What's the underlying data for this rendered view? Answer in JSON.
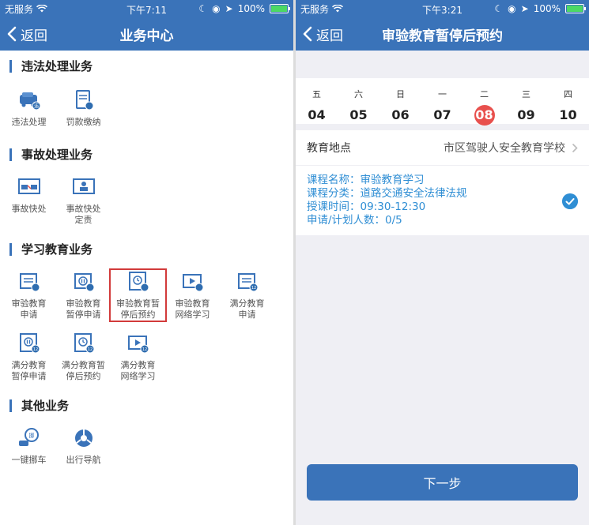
{
  "left": {
    "status": {
      "carrier": "无服务",
      "time": "下午7:11",
      "battery": "100%"
    },
    "nav": {
      "back": "返回",
      "title": "业务中心"
    },
    "sections": [
      {
        "title": "违法处理业务",
        "items": [
          {
            "label": "违法处理",
            "icon": "car-violation-icon"
          },
          {
            "label": "罚款缴纳",
            "icon": "fine-payment-icon"
          }
        ]
      },
      {
        "title": "事故处理业务",
        "items": [
          {
            "label": "事故快处",
            "icon": "accident-quick-icon"
          },
          {
            "label": "事故快处\n定责",
            "icon": "accident-liability-icon"
          }
        ]
      },
      {
        "title": "学习教育业务",
        "items": [
          {
            "label": "审验教育\n申请",
            "icon": "document-icon"
          },
          {
            "label": "审验教育\n暂停申请",
            "icon": "pause-document-icon"
          },
          {
            "label": "审验教育暂\n停后预约",
            "icon": "clock-document-icon",
            "selected": true
          },
          {
            "label": "审验教育\n网络学习",
            "icon": "video-icon"
          },
          {
            "label": "满分教育\n申请",
            "icon": "document-12-icon"
          },
          {
            "label": "满分教育\n暂停申请",
            "icon": "pause-document-12-icon"
          },
          {
            "label": "满分教育暂\n停后预约",
            "icon": "clock-document-12-icon"
          },
          {
            "label": "满分教育\n网络学习",
            "icon": "video-12-icon"
          }
        ]
      },
      {
        "title": "其他业务",
        "items": [
          {
            "label": "一键挪车",
            "icon": "move-car-icon"
          },
          {
            "label": "出行导航",
            "icon": "navigation-icon"
          }
        ]
      }
    ]
  },
  "right": {
    "status": {
      "carrier": "无服务",
      "time": "下午3:21",
      "battery": "100%"
    },
    "nav": {
      "back": "返回",
      "title": "审验教育暂停后预约"
    },
    "days": [
      {
        "weekday": "五",
        "date": "04"
      },
      {
        "weekday": "六",
        "date": "05"
      },
      {
        "weekday": "日",
        "date": "06"
      },
      {
        "weekday": "一",
        "date": "07"
      },
      {
        "weekday": "二",
        "date": "08",
        "active": true
      },
      {
        "weekday": "三",
        "date": "09"
      },
      {
        "weekday": "四",
        "date": "10"
      }
    ],
    "location": {
      "label": "教育地点",
      "value": "市区驾驶人安全教育学校"
    },
    "course": {
      "name": "课程名称：审验教育学习",
      "category": "课程分类：道路交通安全法律法规",
      "time": "授课时间：09:30-12:30",
      "count": "申请/计划人数：0/5"
    },
    "next": "下一步"
  },
  "colors": {
    "brand": "#3a73b9",
    "accent": "#2f8ed4",
    "selected_day": "#e8504d",
    "highlight_box": "#d23a3a"
  }
}
